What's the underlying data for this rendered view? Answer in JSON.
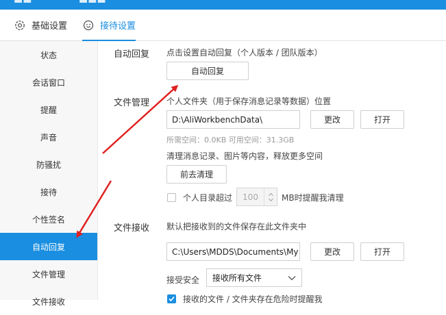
{
  "colors": {
    "accent": "#1a8ee0",
    "arrow": "#e02020",
    "sidebar_bg": "#f7f7f7"
  },
  "tabs": [
    {
      "label": "基础设置",
      "icon": "gear-icon"
    },
    {
      "label": "接待设置",
      "icon": "smiley-icon"
    }
  ],
  "sidebar": {
    "items": [
      {
        "label": "状态"
      },
      {
        "label": "会话窗口"
      },
      {
        "label": "提醒"
      },
      {
        "label": "声音"
      },
      {
        "label": "防骚扰"
      },
      {
        "label": "接待"
      },
      {
        "label": "个性签名"
      },
      {
        "label": "自动回复"
      },
      {
        "label": "文件管理"
      },
      {
        "label": "文件接收"
      }
    ],
    "active_index": 7
  },
  "auto_reply": {
    "label": "自动回复",
    "hint": "点击设置自动回复（个人版本 / 团队版本）",
    "button": "自动回复"
  },
  "file_manage": {
    "label": "文件管理",
    "folder_hint": "个人文件夹（用于保存消息记录等数据）位置",
    "path_value": "D:\\AliWorkbenchData\\",
    "change_button": "更改",
    "open_button": "打开",
    "space_text": "所需空间：0.0KB    可用空间：31.3GB",
    "clean_hint": "清理消息记录、图片等内容，释放更多空间",
    "clean_button": "前去清理",
    "threshold_prefix": "个人目录超过",
    "threshold_value": "100",
    "threshold_suffix": "MB时提醒我清理"
  },
  "file_receive": {
    "label": "文件接收",
    "hint": "默认把接收到的文件保存在此文件夹中",
    "path_value": "C:\\Users\\MDDS\\Documents\\My",
    "change_button": "更改",
    "open_button": "打开",
    "security_label": "接受安全",
    "security_value": "接收所有文件",
    "partial_checkbox_text": "接收的文件 / 文件夹存在危险时提醒我"
  }
}
